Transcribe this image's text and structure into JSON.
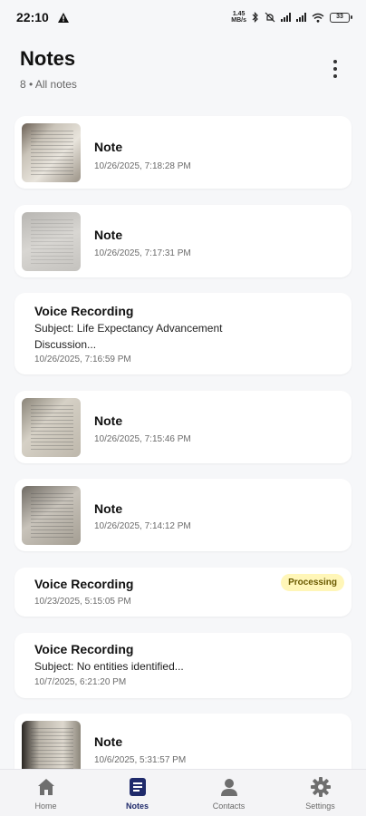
{
  "status_bar": {
    "time": "22:10",
    "alert_icon": "warning-triangle-icon",
    "net_speed_value": "1.45",
    "net_speed_unit": "MB/s",
    "battery": "33"
  },
  "header": {
    "title": "Notes",
    "subtitle": "8 • All notes",
    "more_icon": "more-vertical-icon"
  },
  "notes": [
    {
      "type": "image",
      "title": "Note",
      "date": "10/26/2025, 7:18:28 PM"
    },
    {
      "type": "image",
      "title": "Note",
      "date": "10/26/2025, 7:17:31 PM"
    },
    {
      "type": "voice",
      "title": "Voice Recording",
      "subject": "Subject: Life Expectancy Advancement Discussion...",
      "date": "10/26/2025, 7:16:59 PM"
    },
    {
      "type": "image",
      "title": "Note",
      "date": "10/26/2025, 7:15:46 PM"
    },
    {
      "type": "image",
      "title": "Note",
      "date": "10/26/2025, 7:14:12 PM"
    },
    {
      "type": "voice",
      "title": "Voice Recording",
      "badge": "Processing",
      "date": "10/23/2025, 5:15:05 PM"
    },
    {
      "type": "voice",
      "title": "Voice Recording",
      "subject": "Subject: No entities identified...",
      "date": "10/7/2025, 6:21:20 PM"
    },
    {
      "type": "image",
      "title": "Note",
      "date": "10/6/2025, 5:31:57 PM"
    }
  ],
  "nav": [
    {
      "label": "Home",
      "icon": "home-icon"
    },
    {
      "label": "Notes",
      "icon": "notes-icon",
      "active": true
    },
    {
      "label": "Contacts",
      "icon": "person-icon"
    },
    {
      "label": "Settings",
      "icon": "gear-icon"
    }
  ],
  "colors": {
    "background": "#f6f7f9",
    "card": "#ffffff",
    "badge_bg": "#fff6b8",
    "active_nav": "#1f2a6b"
  }
}
